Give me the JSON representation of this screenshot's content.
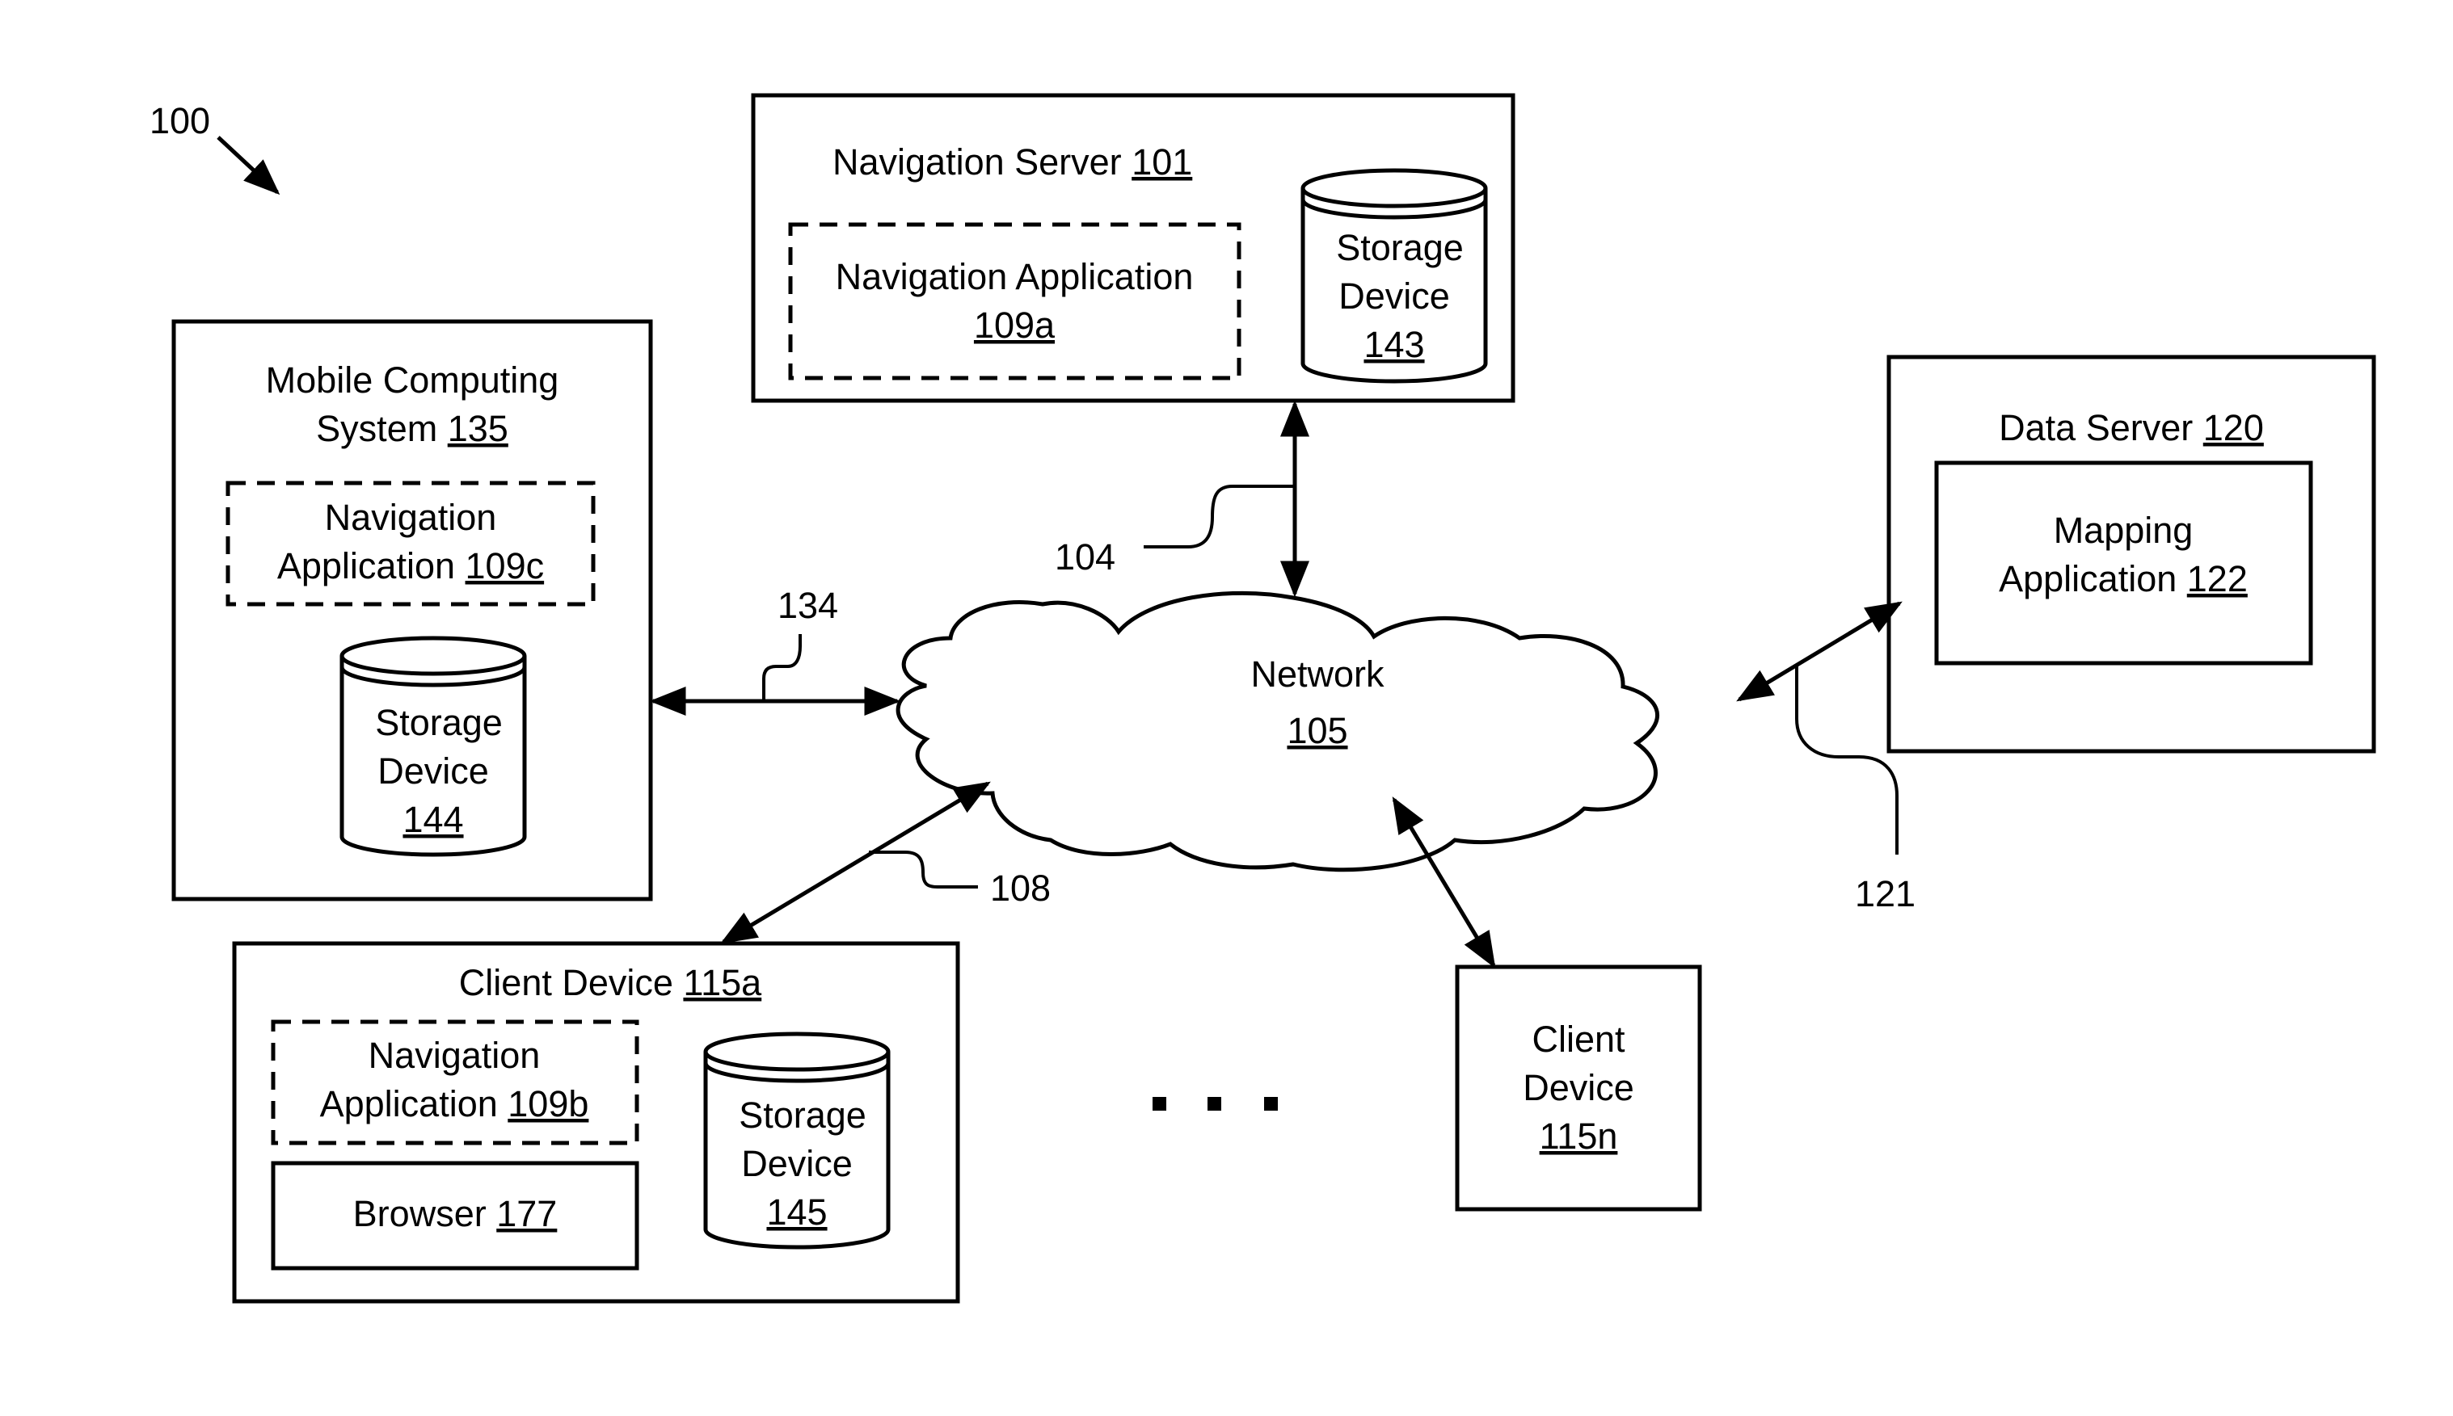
{
  "figure_ref": "100",
  "navigation_server": {
    "title": "Navigation Server",
    "ref": "101",
    "app": {
      "line1": "Navigation Application",
      "ref": "109a"
    },
    "storage": {
      "line1": "Storage",
      "line2": "Device",
      "ref": "143"
    }
  },
  "mobile_computing_system": {
    "line1": "Mobile Computing",
    "line2": "System",
    "ref": "135",
    "app": {
      "line1": "Navigation",
      "line2": "Application",
      "ref": "109c"
    },
    "storage": {
      "line1": "Storage",
      "line2": "Device",
      "ref": "144"
    }
  },
  "data_server": {
    "title": "Data Server",
    "ref": "120",
    "app": {
      "line1": "Mapping",
      "line2": "Application",
      "ref": "122"
    }
  },
  "network": {
    "title": "Network",
    "ref": "105"
  },
  "client_device_a": {
    "title": "Client Device",
    "ref": "115a",
    "app": {
      "line1": "Navigation",
      "line2": "Application",
      "ref": "109b"
    },
    "browser": {
      "label": "Browser",
      "ref": "177"
    },
    "storage": {
      "line1": "Storage",
      "line2": "Device",
      "ref": "145"
    }
  },
  "client_device_n": {
    "line1": "Client",
    "line2": "Device",
    "ref": "115n"
  },
  "connections": {
    "nav_server_network": "104",
    "mobile_network": "134",
    "client_a_network": "108",
    "data_server_network": "121"
  },
  "ellipsis": "..."
}
